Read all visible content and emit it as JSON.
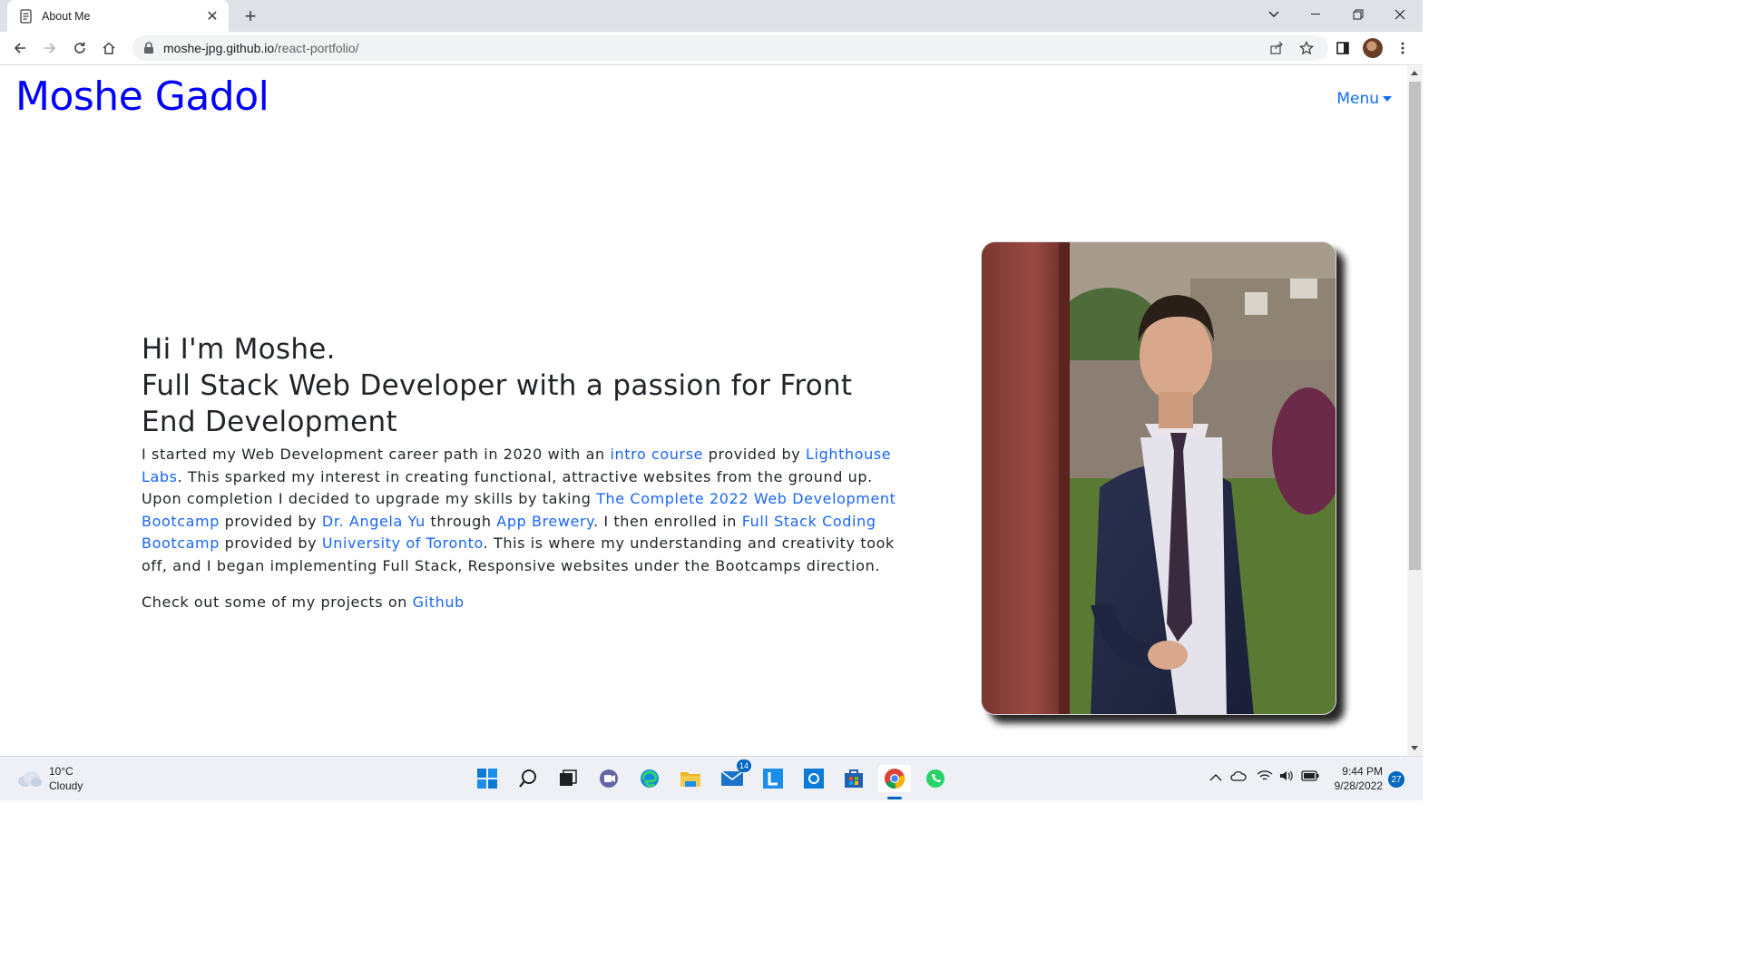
{
  "browser": {
    "tab_title": "About Me",
    "url_host": "moshe-jpg.github.io",
    "url_path": "/react-portfolio/"
  },
  "site": {
    "brand": "Moshe Gadol",
    "menu_label": "Menu",
    "heading_line1": "Hi I'm Moshe.",
    "heading_line2": "Full Stack Web Developer with a passion for Front End Development",
    "para1": {
      "t1": "I started my Web Development career path in 2020 with an ",
      "link_intro": "intro course",
      "t2": " provided by ",
      "link_lighthouse": "Lighthouse Labs",
      "t3": ". This sparked my interest in creating functional, attractive websites from the ground up. Upon completion I decided to upgrade my skills by taking ",
      "link_bootcamp2022": "The Complete 2022 Web Development Bootcamp",
      "t4": " provided by ",
      "link_angela": "Dr. Angela Yu",
      "t5": " through ",
      "link_appbrewery": "App Brewery",
      "t6": ". I then enrolled in ",
      "link_fullstack": "Full Stack Coding Bootcamp",
      "t7": " provided by ",
      "link_uoft": "University of Toronto",
      "t8": ". This is where my understanding and creativity took off, and I began implementing Full Stack, Responsive websites under the Bootcamps direction."
    },
    "para2": {
      "t1": "Check out some of my projects on ",
      "link_github": "Github"
    }
  },
  "taskbar": {
    "temperature": "10°C",
    "condition": "Cloudy",
    "mail_badge": "14",
    "time": "9:44 PM",
    "date": "9/28/2022",
    "notifications": "27"
  },
  "colors": {
    "brand": "#0000ff",
    "link": "#1a66f5",
    "text": "#212529"
  }
}
